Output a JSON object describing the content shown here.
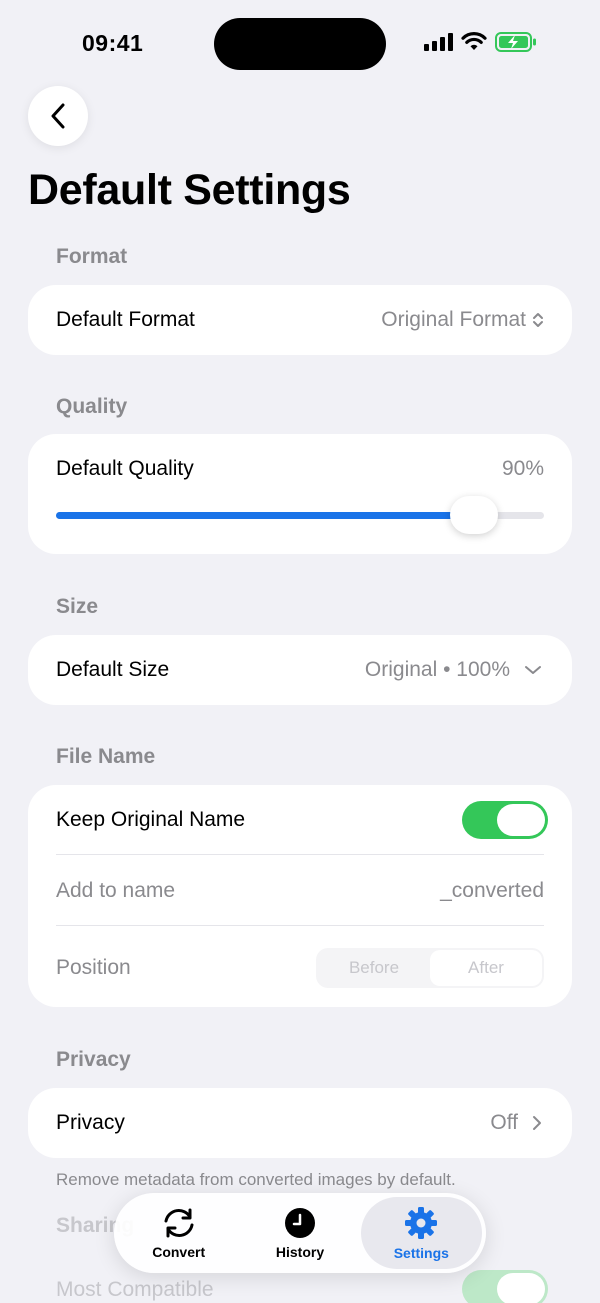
{
  "status_bar": {
    "time": "09:41"
  },
  "page": {
    "title": "Default Settings"
  },
  "format": {
    "section_label": "Format",
    "row_label": "Default Format",
    "value": "Original Format"
  },
  "quality": {
    "section_label": "Quality",
    "row_label": "Default Quality",
    "value_text": "90%",
    "slider_value": 0.9
  },
  "size": {
    "section_label": "Size",
    "row_label": "Default Size",
    "value": "Original • 100%"
  },
  "file_name": {
    "section_label": "File Name",
    "keep_original_label": "Keep Original Name",
    "keep_original_on": true,
    "add_to_name_label": "Add to name",
    "add_to_name_value": "_converted",
    "position_label": "Position",
    "position_options": [
      "Before",
      "After"
    ],
    "position_selected": "After"
  },
  "privacy": {
    "section_label": "Privacy",
    "row_label": "Privacy",
    "value": "Off",
    "footnote": "Remove metadata from converted images by default."
  },
  "sharing": {
    "section_label": "Sharing",
    "row_label": "Most Compatible"
  },
  "tab_bar": {
    "items": [
      {
        "label": "Convert",
        "icon": "convert-icon"
      },
      {
        "label": "History",
        "icon": "clock-icon"
      },
      {
        "label": "Settings",
        "icon": "gear-icon"
      }
    ],
    "active": "Settings"
  },
  "colors": {
    "accent": "#1a73e8",
    "toggle_on": "#34c759",
    "background": "#f1f1f6"
  }
}
